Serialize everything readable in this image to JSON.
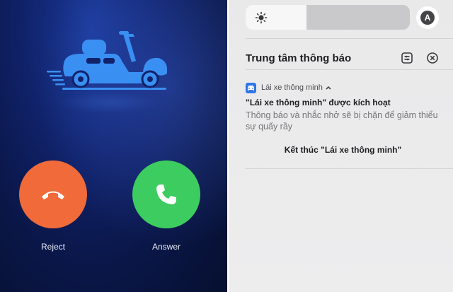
{
  "call": {
    "reject_label": "Reject",
    "answer_label": "Answer",
    "hero_icon": "scooter-icon",
    "colors": {
      "reject": "#f06a3a",
      "answer": "#3dcc5f",
      "icon": "#3a8ff2"
    }
  },
  "shade": {
    "brightness_level": 0.37,
    "auto_brightness_glyph": "A",
    "notification_center": {
      "title": "Trung tâm thông báo",
      "icons": [
        "settings-icon",
        "clear-all-icon"
      ]
    },
    "notification": {
      "app_name": "Lái xe thông minh",
      "title": "\"Lái xe thông minh\" được kích hoạt",
      "body": "Thông báo và nhắc nhở sẽ bị chặn để giảm thiểu sự quấy rầy",
      "action": "Kết thúc \"Lái xe thông minh\""
    }
  }
}
